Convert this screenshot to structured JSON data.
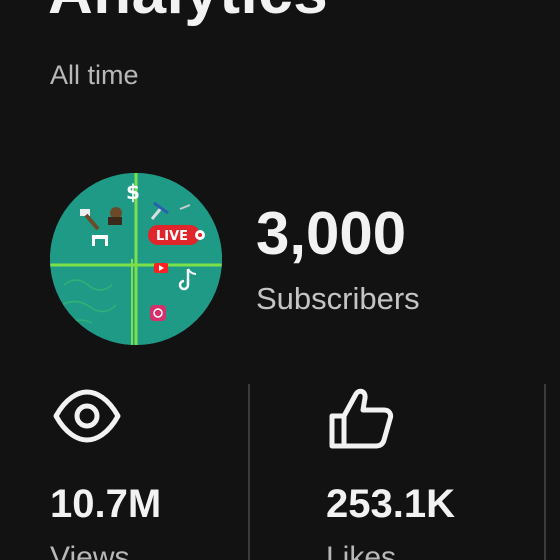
{
  "header": {
    "title": "Analytics",
    "period": "All time"
  },
  "channel": {
    "avatar_icon": "channel-avatar-logo",
    "avatar_live_badge": "LIVE",
    "subscribers_value": "3,000",
    "subscribers_label": "Subscribers"
  },
  "stats": [
    {
      "icon": "eye-icon",
      "value": "10.7M",
      "label": "Views"
    },
    {
      "icon": "thumbs-up-icon",
      "value": "253.1K",
      "label": "Likes"
    }
  ],
  "colors": {
    "background": "#121212",
    "text": "#f2f2f2",
    "muted_text": "#b8b8b8",
    "avatar_teal": "#1f9a86",
    "avatar_lines": "#7be04a",
    "live_red": "#e0252b"
  }
}
